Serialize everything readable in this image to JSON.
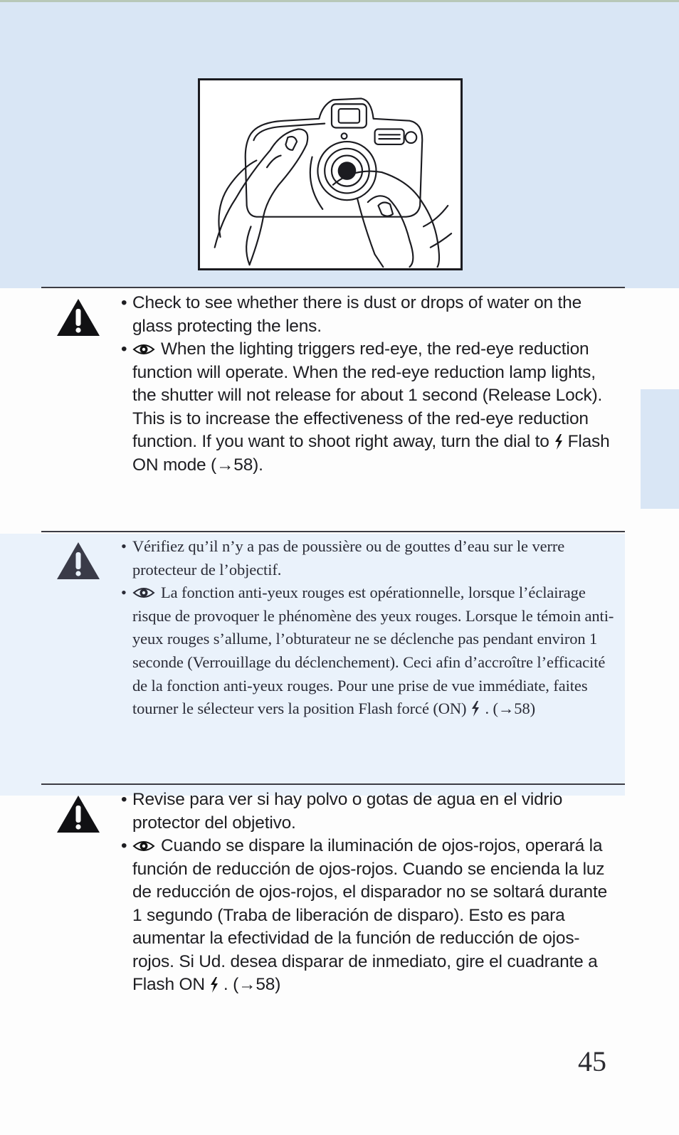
{
  "page": {
    "number": "45",
    "colors": {
      "band": "#d9e6f5",
      "french_band": "#eaf2fb",
      "text": "#1e1e22"
    }
  },
  "illustration": {
    "subject": "hands wiping camera lens with cloth",
    "icon": "camera-lens-cleaning-illustration"
  },
  "english": {
    "warning_icon": "warning-triangle-icon",
    "item1": "Check to see whether there is dust or drops of water on the glass protecting the lens.",
    "item2_pre": "When the lighting triggers red-eye, the red-eye reduction function will operate. When the red-eye reduction lamp lights, the shutter will not release for about 1 second (Release Lock). This is to increase the effectiveness of the red-eye reduction function. If you want to shoot right away, turn the dial to",
    "item2_post": "Flash ON mode (→58)."
  },
  "french": {
    "warning_icon": "warning-triangle-icon",
    "item1": "Vérifiez qu’il n’y a pas de poussière ou de gouttes d’eau sur le verre protecteur de l’objectif.",
    "item2_pre": "La fonction anti-yeux rouges est opérationnelle, lorsque l’éclairage risque de provoquer le phénomène des yeux rouges. Lorsque le témoin anti-yeux rouges s’allume, l’obturateur ne se déclenche pas pendant environ 1 seconde (Verrouillage du déclenchement). Ceci afin d’accroître l’efficacité de la fonction anti-yeux rouges. Pour une prise de vue immédiate, faites tourner le sélecteur vers la position Flash forcé (ON)",
    "item2_post": ". (→58)"
  },
  "spanish": {
    "warning_icon": "warning-triangle-icon",
    "item1": "Revise para ver si hay polvo o gotas de agua en el vidrio protector del objetivo.",
    "item2_pre": "Cuando se dispare la iluminación de ojos-rojos, operará la función de reducción de ojos-rojos. Cuando se encienda la luz de reducción de ojos-rojos, el disparador no se soltará durante 1 segundo (Traba de liberación de disparo). Esto es para aumentar la efectividad de la función de reducción de ojos-rojos. Si Ud. desea disparar de inmediato, gire el cuadrante a Flash ON",
    "item2_post": ". (→58)"
  },
  "icons": {
    "red_eye": "red-eye-reduction-icon",
    "flash": "flash-on-icon"
  }
}
